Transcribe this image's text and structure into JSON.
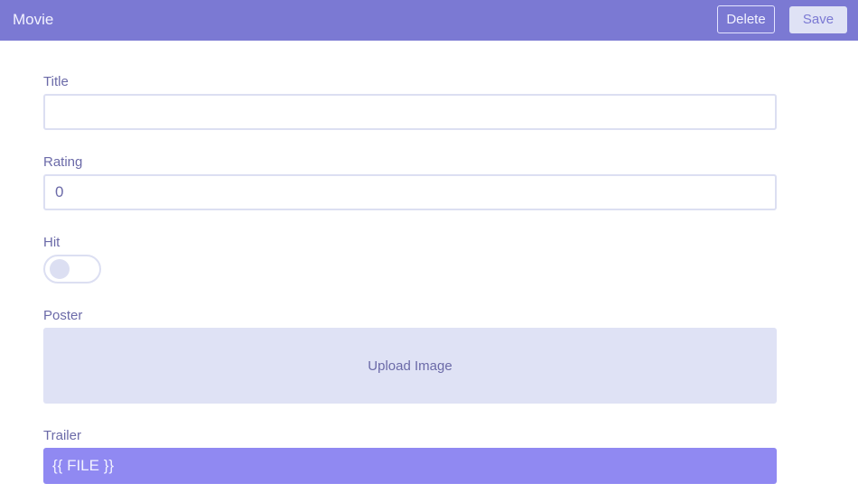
{
  "header": {
    "title": "Movie",
    "delete_label": "Delete",
    "save_label": "Save"
  },
  "form": {
    "title_label": "Title",
    "title_value": "",
    "rating_label": "Rating",
    "rating_value": "0",
    "hit_label": "Hit",
    "hit_on": false,
    "poster_label": "Poster",
    "upload_label": "Upload Image",
    "trailer_label": "Trailer",
    "trailer_value": "{{ FILE }}"
  },
  "colors": {
    "accent": "#7b79d3",
    "trailer_bg": "#9089f2",
    "upload_bg": "#dfe2f5",
    "border": "#dcdff2",
    "text": "#6b6aa8"
  }
}
